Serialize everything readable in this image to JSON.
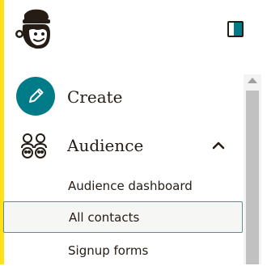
{
  "brand": {
    "accent_color": "#ffe01b",
    "teal_color": "#007c89",
    "logo_icon": "freddie-monkey-logo"
  },
  "header": {
    "toggle_icon": "sidebar-collapse-icon"
  },
  "nav": {
    "create": {
      "label": "Create",
      "icon": "pencil-icon"
    },
    "audience": {
      "label": "Audience",
      "icon": "audience-icon",
      "expanded": true,
      "items": [
        {
          "label": "Audience dashboard",
          "selected": false
        },
        {
          "label": "All contacts",
          "selected": true
        },
        {
          "label": "Signup forms",
          "selected": false
        }
      ]
    }
  }
}
